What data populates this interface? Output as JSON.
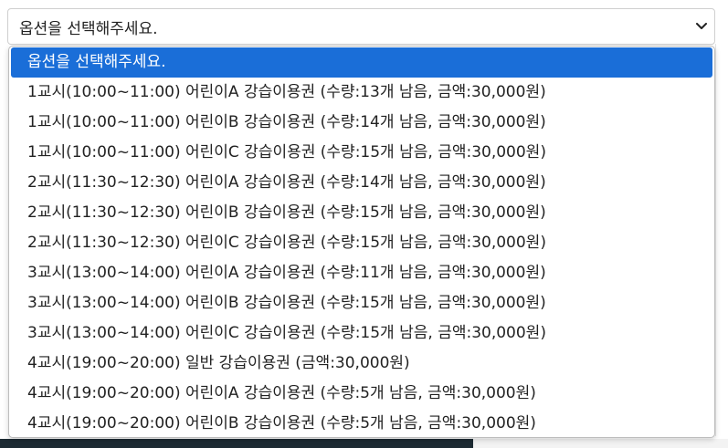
{
  "select": {
    "value": "옵션을 선택해주세요.",
    "chevron_icon": "chevron-down-icon"
  },
  "colors": {
    "selected_bg": "#1a6ed8",
    "bottom_bar": "#1d2b33"
  },
  "options": [
    {
      "label": "옵션을 선택해주세요.",
      "selected": true
    },
    {
      "label": "1교시(10:00~11:00) 어린이A 강습이용권 (수량:13개 남음, 금액:30,000원)"
    },
    {
      "label": "1교시(10:00~11:00) 어린이B 강습이용권 (수량:14개 남음, 금액:30,000원)"
    },
    {
      "label": "1교시(10:00~11:00) 어린이C 강습이용권 (수량:15개 남음, 금액:30,000원)"
    },
    {
      "label": "2교시(11:30~12:30) 어린이A 강습이용권 (수량:14개 남음, 금액:30,000원)"
    },
    {
      "label": "2교시(11:30~12:30) 어린이B 강습이용권 (수량:15개 남음, 금액:30,000원)"
    },
    {
      "label": "2교시(11:30~12:30) 어린이C 강습이용권 (수량:15개 남음, 금액:30,000원)"
    },
    {
      "label": "3교시(13:00~14:00) 어린이A 강습이용권 (수량:11개 남음, 금액:30,000원)"
    },
    {
      "label": "3교시(13:00~14:00) 어린이B 강습이용권 (수량:15개 남음, 금액:30,000원)"
    },
    {
      "label": "3교시(13:00~14:00) 어린이C 강습이용권 (수량:15개 남음, 금액:30,000원)"
    },
    {
      "label": "4교시(19:00~20:00) 일반 강습이용권 (금액:30,000원)"
    },
    {
      "label": "4교시(19:00~20:00) 어린이A 강습이용권 (수량:5개 남음, 금액:30,000원)"
    },
    {
      "label": "4교시(19:00~20:00) 어린이B 강습이용권 (수량:5개 남음, 금액:30,000원)"
    }
  ]
}
